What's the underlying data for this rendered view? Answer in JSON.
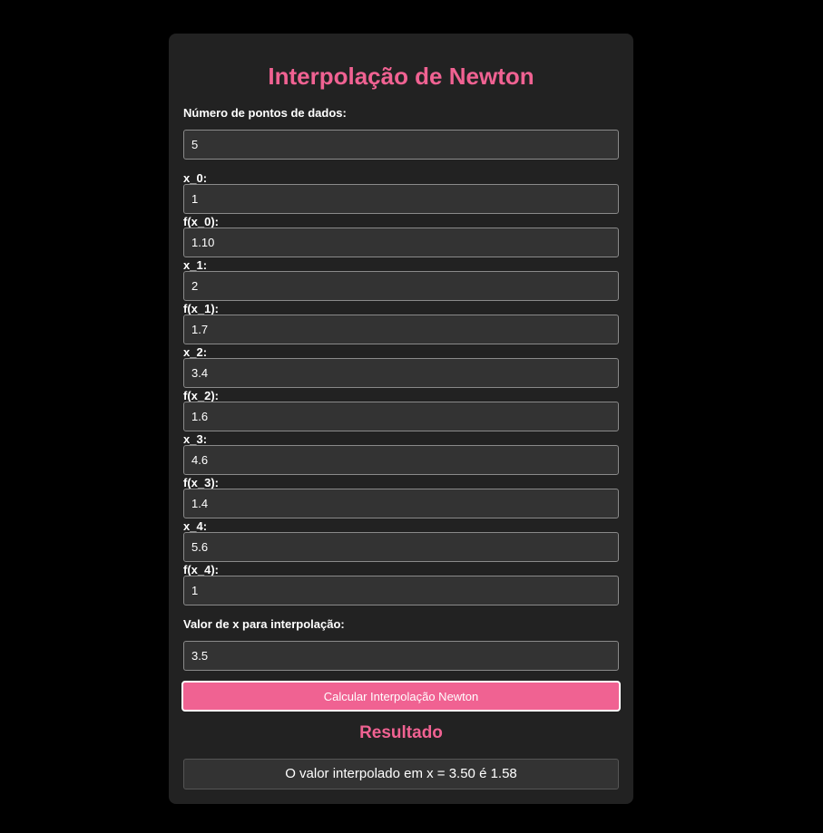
{
  "title": "Interpolação de Newton",
  "num_points": {
    "label": "Número de pontos de dados:",
    "value": "5"
  },
  "points": [
    {
      "x_label": "x_0:",
      "x_value": "1",
      "fx_label": "f(x_0):",
      "fx_value": "1.10"
    },
    {
      "x_label": "x_1:",
      "x_value": "2",
      "fx_label": "f(x_1):",
      "fx_value": "1.7"
    },
    {
      "x_label": "x_2:",
      "x_value": "3.4",
      "fx_label": "f(x_2):",
      "fx_value": "1.6"
    },
    {
      "x_label": "x_3:",
      "x_value": "4.6",
      "fx_label": "f(x_3):",
      "fx_value": "1.4"
    },
    {
      "x_label": "x_4:",
      "x_value": "5.6",
      "fx_label": "f(x_4):",
      "fx_value": "1"
    }
  ],
  "interp_x": {
    "label": "Valor de x para interpolação:",
    "value": "3.5"
  },
  "calculate_button": "Calcular Interpolação Newton",
  "result": {
    "title": "Resultado",
    "text": "O valor interpolado em x = 3.50 é 1.58"
  },
  "colors": {
    "accent": "#f06292",
    "background": "#000000",
    "card": "#222222",
    "input_bg": "#333333"
  }
}
